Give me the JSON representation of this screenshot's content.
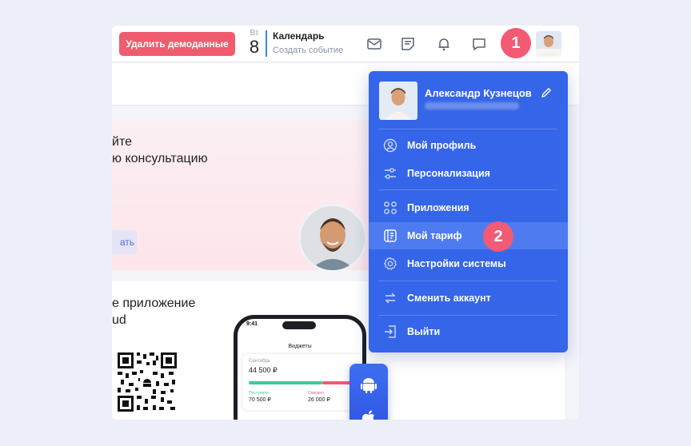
{
  "header": {
    "demo_button": "Удалить демоданные",
    "date_dow": "Вт",
    "date_day": "8",
    "calendar_title": "Календарь",
    "calendar_sub": "Создать событие",
    "icons": [
      "mail-icon",
      "notes-icon",
      "bell-icon",
      "chat-icon"
    ]
  },
  "promo": {
    "line1": "йте",
    "line2": "ю консультацию",
    "button": "ать"
  },
  "app": {
    "line1": "е приложение",
    "line2": "ud",
    "phone": {
      "time": "9:41",
      "title": "Виджеты",
      "month": "Сентябрь",
      "amount": "44 500 ₽",
      "in_label": "Поступило",
      "in_value": "70 500 ₽",
      "out_label": "Списано",
      "out_value": "26 000 ₽"
    }
  },
  "menu": {
    "name": "Александр Кузнецов",
    "items": [
      {
        "label": "Мой профиль",
        "icon": "user-circle-icon"
      },
      {
        "label": "Персонализация",
        "icon": "sliders-icon"
      },
      {
        "label": "Приложения",
        "icon": "grid-icon"
      },
      {
        "label": "Мой тариф",
        "icon": "tariff-icon",
        "active": true
      },
      {
        "label": "Настройки системы",
        "icon": "gear-icon"
      },
      {
        "label": "Сменить аккаунт",
        "icon": "swap-icon"
      },
      {
        "label": "Выйти",
        "icon": "logout-icon"
      }
    ]
  },
  "badges": [
    "1",
    "2"
  ],
  "colors": {
    "accent": "#3565e8",
    "danger": "#f15b6f",
    "badge": "#f35a74"
  }
}
